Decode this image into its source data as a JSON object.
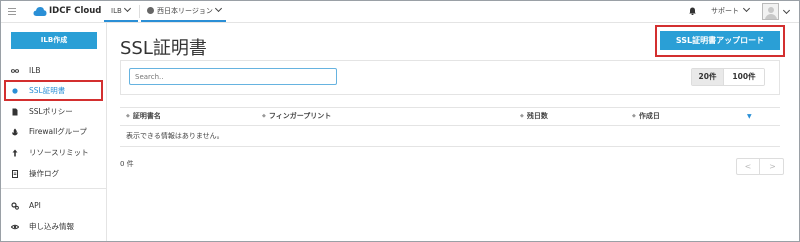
{
  "header": {
    "logo_text": "IDCF Cloud",
    "service_tab": "ILB",
    "region_tab": "西日本リージョン",
    "support_label": "サポート"
  },
  "sidebar": {
    "create_button": "ILB作成",
    "items": [
      {
        "label": "ILB",
        "icon": "infinity-icon"
      },
      {
        "label": "SSL証明書",
        "icon": "dot-icon",
        "active": true
      },
      {
        "label": "SSLポリシー",
        "icon": "file-icon"
      },
      {
        "label": "Firewallグループ",
        "icon": "fire-icon"
      },
      {
        "label": "リソースリミット",
        "icon": "arrow-icon"
      },
      {
        "label": "操作ログ",
        "icon": "document-icon"
      },
      {
        "label": "API",
        "icon": "gear-icon"
      },
      {
        "label": "申し込み情報",
        "icon": "eye-icon"
      }
    ]
  },
  "main": {
    "title": "SSL証明書",
    "upload_button": "SSL証明書アップロード",
    "search_placeholder": "Search..",
    "page_sizes": [
      "20件",
      "100件"
    ],
    "selected_page_size": "20件",
    "columns": [
      "証明書名",
      "フィンガープリント",
      "残日数",
      "作成日"
    ],
    "empty_message": "表示できる情報はありません。",
    "count": "0 件",
    "pager_prev": "<",
    "pager_next": ">"
  },
  "colors": {
    "accent": "#2a9fd6",
    "highlight": "#d32f2f"
  }
}
